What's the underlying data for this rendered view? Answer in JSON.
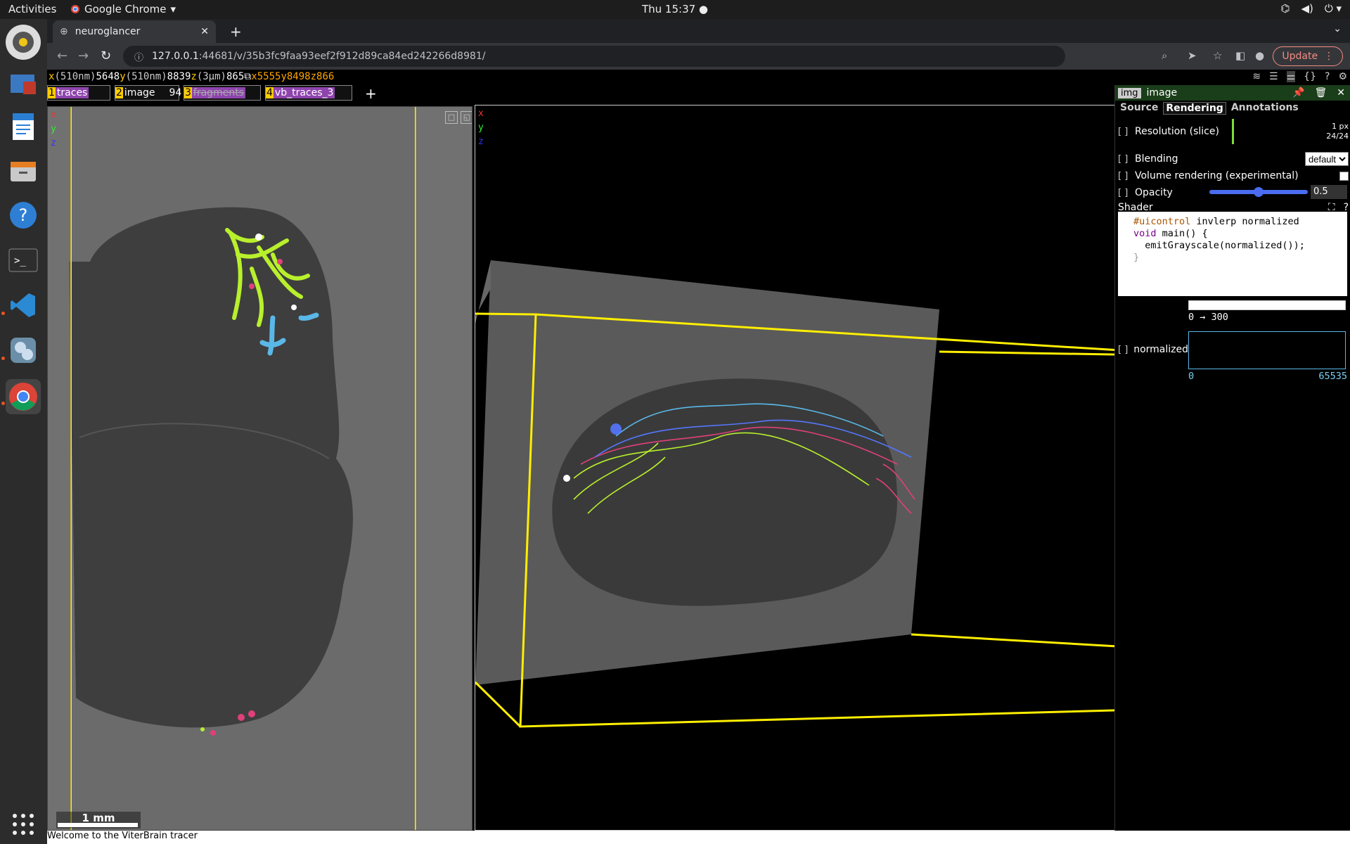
{
  "topbar": {
    "activities": "Activities",
    "app_name": "Google Chrome",
    "clock": "Thu 15:37 ●"
  },
  "chrome": {
    "tab_title": "neuroglancer",
    "url_host": "127.0.0.1",
    "url_rest": ":44681/v/35b3fc9faa93eef2f912d89ca84ed242266d8981/",
    "update_label": "Update"
  },
  "coords": {
    "x_unit": "510nm",
    "x_val": "5648",
    "y_unit": "510nm",
    "y_val": "8839",
    "z_unit": "3μm",
    "z_val": "865",
    "mx": "5555",
    "my": "8498",
    "mz": "866"
  },
  "layers": [
    {
      "num": "1",
      "name": "traces"
    },
    {
      "num": "2",
      "name": "image",
      "extra": "94"
    },
    {
      "num": "3",
      "name": "fragments"
    },
    {
      "num": "4",
      "name": "vb_traces_3"
    }
  ],
  "scalebar": "1 mm",
  "status": "Welcome to the ViterBrain tracer",
  "side": {
    "type_badge": "img",
    "layer_name": "image",
    "tabs": [
      "Source",
      "Rendering",
      "Annotations"
    ],
    "resolution_label": "Resolution (slice)",
    "res_px": "1 px",
    "res_count": "24/24",
    "blending_label": "Blending",
    "blending_value": "default",
    "volume_label": "Volume rendering (experimental)",
    "opacity_label": "Opacity",
    "opacity_value": "0.5",
    "shader_label": "Shader",
    "shader_line1_dir": "#uicontrol",
    "shader_line1_rest": " invlerp normalized",
    "shader_line2_kw": "void",
    "shader_line2_rest": " main() {",
    "shader_line3": "  emitGrayscale(normalized());",
    "shader_line4": "}",
    "range_min": "0",
    "range_max": "300",
    "normalized_label": "normalized",
    "norm_min": "0",
    "norm_max": "65535"
  }
}
